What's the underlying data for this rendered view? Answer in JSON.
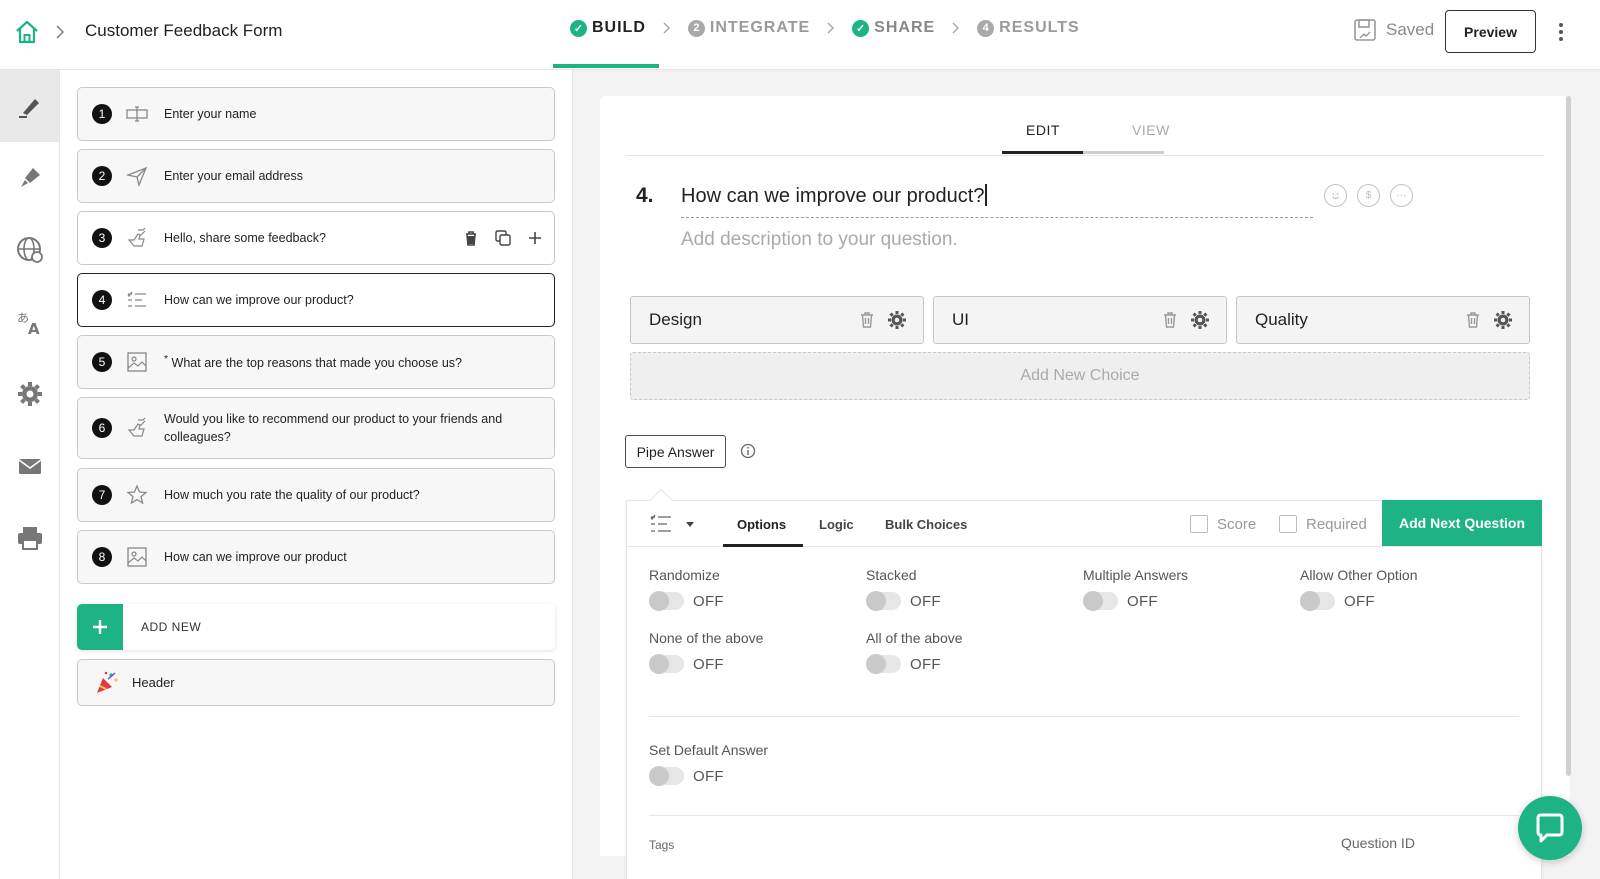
{
  "header": {
    "form_title": "Customer Feedback Form",
    "steps": [
      {
        "label": "BUILD",
        "state": "active",
        "marker": "check"
      },
      {
        "label": "INTEGRATE",
        "state": "pending",
        "marker": "2"
      },
      {
        "label": "SHARE",
        "state": "done",
        "marker": "check"
      },
      {
        "label": "RESULTS",
        "state": "pending",
        "marker": "4"
      }
    ],
    "saved_label": "Saved",
    "preview_label": "Preview"
  },
  "rail": {
    "items": [
      "build-pen-icon",
      "design-brush-icon",
      "language-globe-icon",
      "translate-icon",
      "settings-gear-icon",
      "email-icon",
      "print-icon"
    ],
    "active_index": 0
  },
  "questions": [
    {
      "num": "1",
      "icon": "text-input-icon",
      "text": "Enter your name"
    },
    {
      "num": "2",
      "icon": "send-icon",
      "text": "Enter your email address"
    },
    {
      "num": "3",
      "icon": "thumbs-icon",
      "text": "Hello, share some feedback?"
    },
    {
      "num": "4",
      "icon": "list-icon",
      "text": "How can we improve our product?"
    },
    {
      "num": "5",
      "icon": "image-icon",
      "text": "What are the top reasons that made you choose us?",
      "required_mark": "*"
    },
    {
      "num": "6",
      "icon": "thumbs-icon",
      "text": "Would you like to recommend our product to your friends and colleagues?"
    },
    {
      "num": "7",
      "icon": "star-icon",
      "text": "How much you rate the quality of our product?"
    },
    {
      "num": "8",
      "icon": "image-icon",
      "text": "How can we improve our product"
    }
  ],
  "add_new_label": "ADD NEW",
  "header_item_label": "Header",
  "editor": {
    "tabs": {
      "edit": "EDIT",
      "view": "VIEW"
    },
    "question_number": "4.",
    "question_title": "How can we improve our product?",
    "description_placeholder": "Add description to your question.",
    "choices": [
      "Design",
      "UI",
      "Quality"
    ],
    "add_choice_label": "Add New Choice",
    "pipe_answer_label": "Pipe Answer"
  },
  "options_panel": {
    "tabs": [
      "Options",
      "Logic",
      "Bulk Choices"
    ],
    "score_label": "Score",
    "required_label": "Required",
    "next_button": "Add Next Question",
    "toggles": [
      {
        "label": "Randomize",
        "value": "OFF"
      },
      {
        "label": "Stacked",
        "value": "OFF"
      },
      {
        "label": "Multiple Answers",
        "value": "OFF"
      },
      {
        "label": "Allow Other Option",
        "value": "OFF"
      },
      {
        "label": "None of the above",
        "value": "OFF"
      },
      {
        "label": "All of the above",
        "value": "OFF"
      }
    ],
    "default_answer": {
      "label": "Set Default Answer",
      "value": "OFF"
    },
    "tags_label": "Tags",
    "question_id_label": "Question ID"
  },
  "colors": {
    "accent": "#1eb384",
    "dark": "#222222"
  }
}
